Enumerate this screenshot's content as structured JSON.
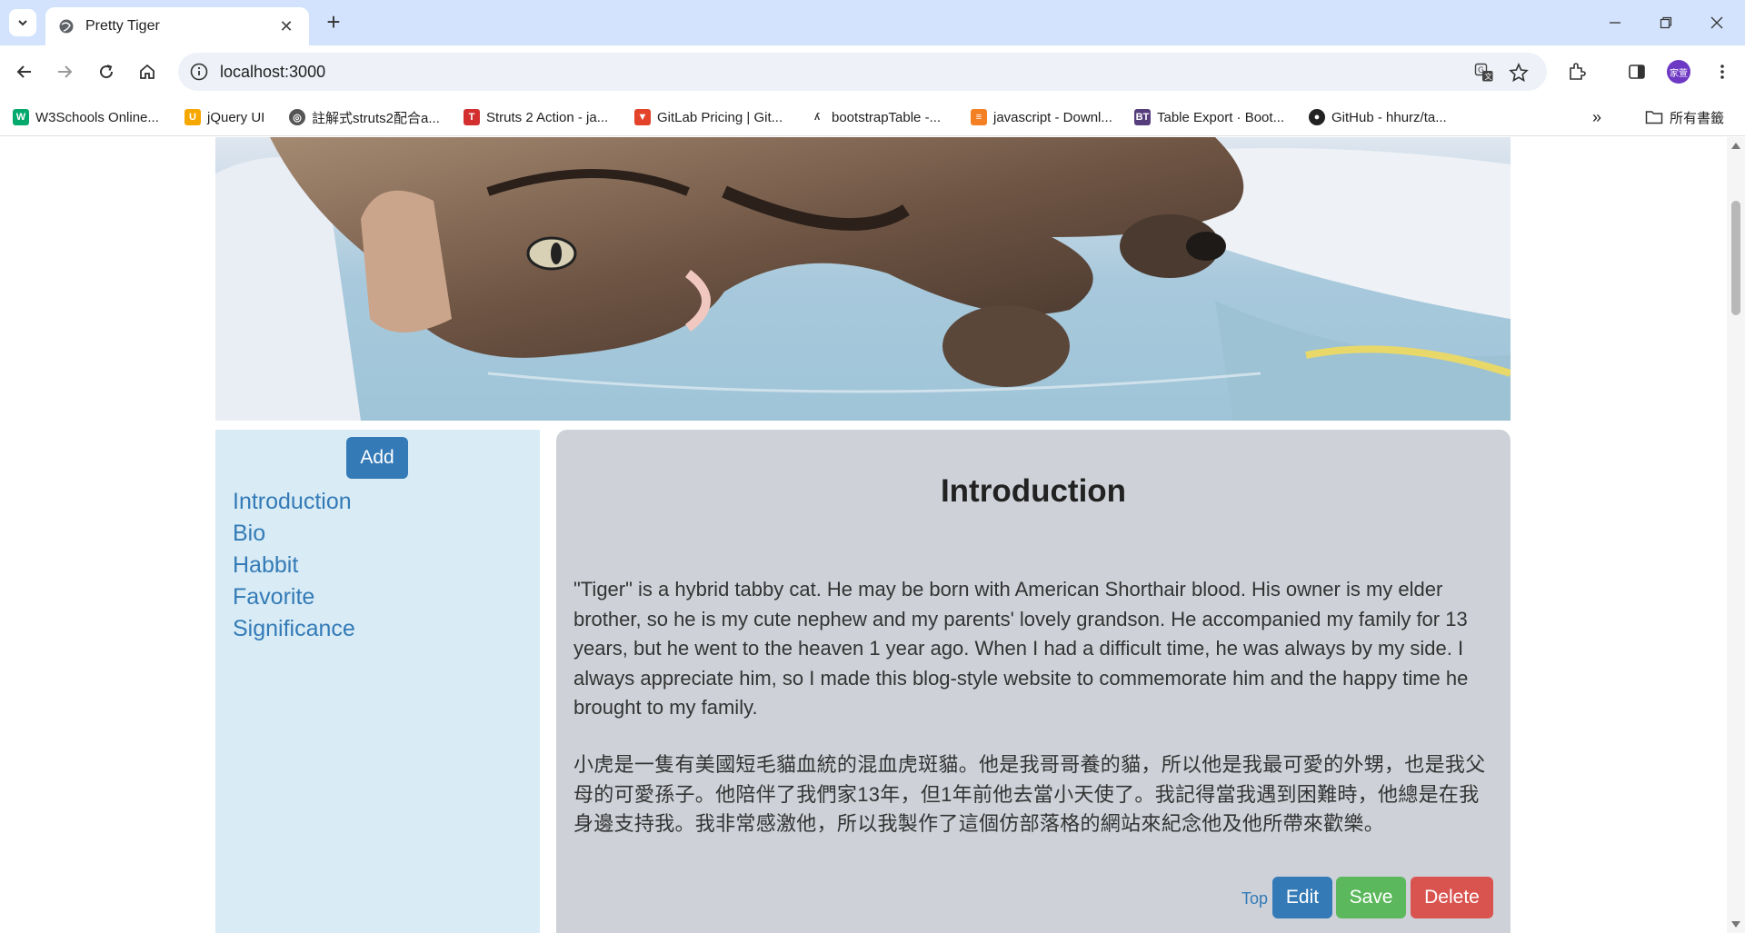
{
  "browser": {
    "tab_title": "Pretty Tiger",
    "url": "localhost:3000",
    "profile_initials": "家萱",
    "bookmarks": [
      {
        "label": "W3Schools Online...",
        "icon": "w3schools-icon",
        "color": "#04aa6d"
      },
      {
        "label": "jQuery UI",
        "icon": "jquery-ui-icon",
        "color": "#f7a800"
      },
      {
        "label": "註解式struts2配合a...",
        "icon": "globe-icon",
        "color": "#555555"
      },
      {
        "label": "Struts 2 Action - ja...",
        "icon": "struts-icon",
        "color": "#d32f2f"
      },
      {
        "label": "GitLab Pricing | Git...",
        "icon": "gitlab-icon",
        "color": "#e2432a"
      },
      {
        "label": "bootstrapTable -...",
        "icon": "bootstrap-table-icon",
        "color": "#333333"
      },
      {
        "label": "javascript - Downl...",
        "icon": "stackoverflow-icon",
        "color": "#f48024"
      },
      {
        "label": "Table Export · Boot...",
        "icon": "bt-icon",
        "color": "#563d7c"
      },
      {
        "label": "GitHub - hhurz/ta...",
        "icon": "github-icon",
        "color": "#222222"
      }
    ],
    "all_bookmarks_label": "所有書籤"
  },
  "sidebar": {
    "add_label": "Add",
    "items": [
      {
        "label": "Introduction"
      },
      {
        "label": "Bio"
      },
      {
        "label": "Habbit"
      },
      {
        "label": "Favorite"
      },
      {
        "label": "Significance"
      }
    ]
  },
  "content": {
    "title": "Introduction",
    "paragraph_en": "\"Tiger\" is a hybrid tabby cat. He may be born with American Shorthair blood. His owner is my elder brother, so he is my cute nephew and my parents' lovely grandson. He accompanied my family for 13 years, but he went to the heaven 1 year ago. When I had a difficult time, he was always by my side. I always appreciate him, so I made this blog-style website to commemorate him and the happy time he brought to my family.",
    "paragraph_zh": "小虎是一隻有美國短毛貓血統的混血虎斑貓。他是我哥哥養的貓，所以他是我最可愛的外甥，也是我父母的可愛孫子。他陪伴了我們家13年，但1年前他去當小天使了。我記得當我遇到困難時，他總是在我身邊支持我。我非常感激他，所以我製作了這個仿部落格的網站來紀念他及他所帶來歡樂。",
    "top_link": "Top",
    "edit_label": "Edit",
    "save_label": "Save",
    "delete_label": "Delete"
  },
  "colors": {
    "primary": "#337ab7",
    "success": "#5cb85c",
    "danger": "#d9534f",
    "sidebar_bg": "#d9ecf5",
    "content_bg": "#ced2d8"
  }
}
